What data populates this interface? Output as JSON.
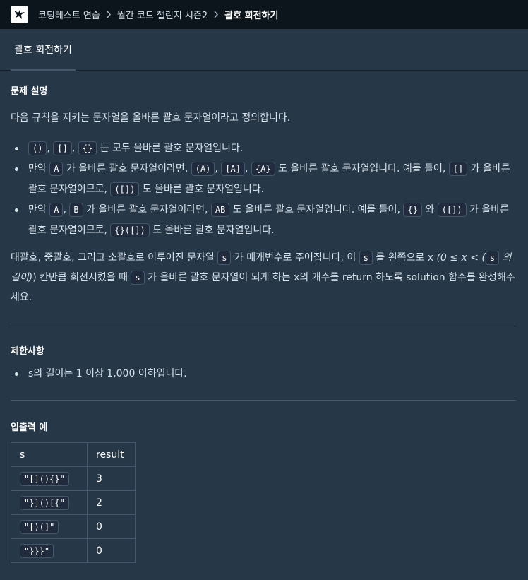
{
  "breadcrumb": {
    "items": [
      "코딩테스트 연습",
      "월간 코드 챌린지 시즌2"
    ],
    "current": "괄호 회전하기"
  },
  "tab": {
    "label": "괄호 회전하기"
  },
  "description": {
    "heading": "문제 설명",
    "intro": "다음 규칙을 지키는 문자열을 올바른 괄호 문자열이라고 정의합니다.",
    "rule1": {
      "codes": [
        "()",
        "[]",
        "{}"
      ],
      "sep": ",",
      "text": "는 모두 올바른 괄호 문자열입니다."
    },
    "rule2": {
      "pre": "만약",
      "code_a": "A",
      "mid": "가 올바른 괄호 문자열이라면,",
      "codes": [
        "(A)",
        "[A]",
        "{A}"
      ],
      "text1": "도 올바른 괄호 문자열입니다. 예를 들어,",
      "code_ex1": "[]",
      "text2": "가 올바른 괄호 문자열이므로,",
      "code_ex2": "([])",
      "text3": "도 올바른 괄호 문자열입니다."
    },
    "rule3": {
      "pre": "만약",
      "code_a": "A",
      "code_b": "B",
      "mid": "가 올바른 괄호 문자열이라면,",
      "code_ab": "AB",
      "text1": "도 올바른 괄호 문자열입니다. 예를 들어,",
      "code_ex1": "{}",
      "text_wa": "와",
      "code_ex2": "([])",
      "text2": "가 올바른 괄호 문자열이므로,",
      "code_ex3": "{}([])",
      "text3": "도 올바른 괄호 문자열입니다."
    },
    "body": {
      "t1": "대괄호, 중괄호, 그리고 소괄호로 이루어진 문자열",
      "code_s": "s",
      "t2": "가 매개변수로 주어집니다. 이",
      "t3": "를 왼쪽으로 x",
      "t4": "(0 ≤ x < (",
      "t5": "의 길이)",
      "t6": ") 칸만큼 회전시켰을 때",
      "t7": "가 올바른 괄호 문자열이 되게 하는 x의 개수를 return 하도록",
      "t8": "solution 함수를 완성해주세요."
    }
  },
  "constraints": {
    "heading": "제한사항",
    "items": [
      "s의 길이는 1 이상 1,000 이하입니다."
    ]
  },
  "examples": {
    "heading": "입출력 예",
    "headers": [
      "s",
      "result"
    ],
    "rows": [
      {
        "s": "\"[](){}\"",
        "result": "3"
      },
      {
        "s": "\"}]()[{\"",
        "result": "2"
      },
      {
        "s": "\"[)(]\"",
        "result": "0"
      },
      {
        "s": "\"}}}\"",
        "result": "0"
      }
    ]
  },
  "colors": {
    "background": "#263747",
    "topbar": "#0c151c",
    "code_bg": "#202b3d",
    "border": "#44576c"
  }
}
